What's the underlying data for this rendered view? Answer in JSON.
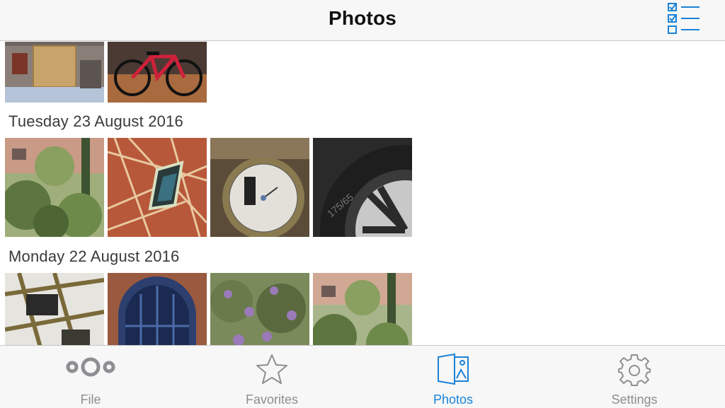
{
  "navbar": {
    "title": "Photos",
    "select_icon": "checklist-icon"
  },
  "sections": [
    {
      "header": "",
      "photos": [
        "wall-with-wooden-board",
        "red-bicycle-indoor"
      ]
    },
    {
      "header": "Tuesday 23 August 2016",
      "photos": [
        "garden-trees",
        "artistic-abstract",
        "water-meter-dial",
        "car-tire"
      ]
    },
    {
      "header": "Monday 22 August 2016",
      "photos": [
        "metal-frame-construction",
        "blue-arched-window",
        "purple-flowers-bush",
        "garden-house-trees"
      ]
    }
  ],
  "tabbar": {
    "tabs": [
      {
        "label": "File",
        "icon": "nextcloud-logo-icon",
        "active": false
      },
      {
        "label": "Favorites",
        "icon": "star-icon",
        "active": false
      },
      {
        "label": "Photos",
        "icon": "photos-icon",
        "active": true
      },
      {
        "label": "Settings",
        "icon": "gear-icon",
        "active": false
      }
    ]
  },
  "colors": {
    "accent": "#1a82d8",
    "inactive": "#8e8e93",
    "bar_background": "#f7f7f7"
  }
}
